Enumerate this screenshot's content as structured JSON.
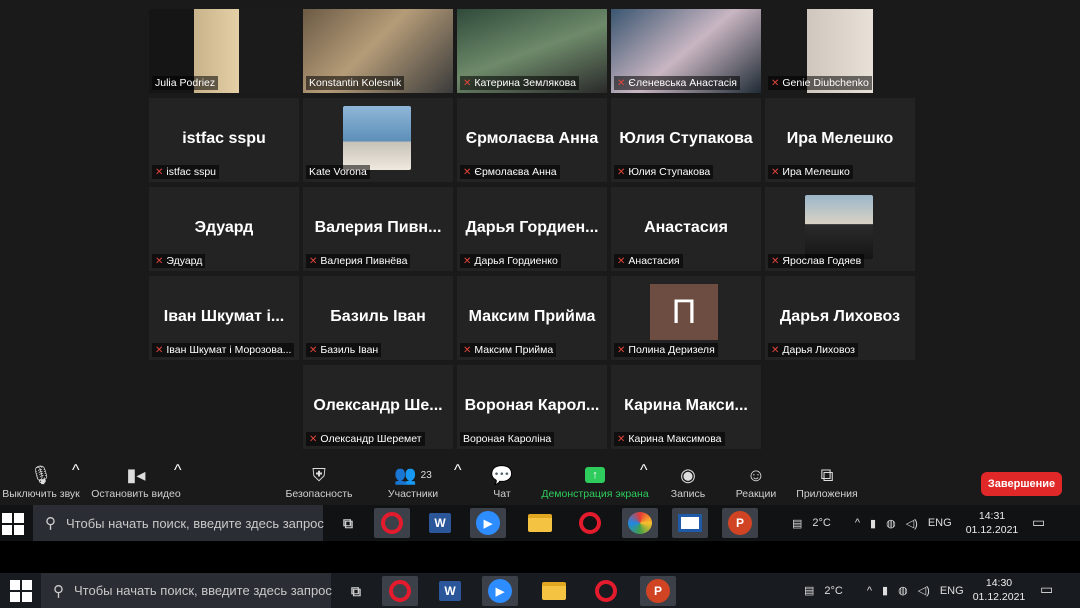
{
  "participants": [
    {
      "big": "",
      "caption": "Julia Podriez",
      "video": "photo",
      "active": true,
      "mic_muted": false
    },
    {
      "big": "",
      "caption": "Konstantin Kolesnik",
      "video": "photo",
      "mic_muted": false
    },
    {
      "big": "",
      "caption": "Катерина Землякова",
      "video": "photo",
      "mic_muted": true
    },
    {
      "big": "",
      "caption": "Єленевська Анастасія",
      "video": "photo",
      "mic_muted": true
    },
    {
      "big": "",
      "caption": "Genie Diubchenko",
      "video": "photo",
      "mic_muted": true
    },
    {
      "big": "istfac sspu",
      "caption": "istfac sspu",
      "video": "none",
      "mic_muted": true
    },
    {
      "big": "",
      "caption": "Kate Vorona",
      "video": "thumb",
      "mic_muted": false
    },
    {
      "big": "Єрмолаєва Анна",
      "caption": "Єрмолаєва Анна",
      "video": "none",
      "mic_muted": true
    },
    {
      "big": "Юлия Ступакова",
      "caption": "Юлия Ступакова",
      "video": "none",
      "mic_muted": true
    },
    {
      "big": "Ира Мелешко",
      "caption": "Ира Мелешко",
      "video": "none",
      "mic_muted": true
    },
    {
      "big": "Эдуард",
      "caption": "Эдуард",
      "video": "none",
      "mic_muted": true
    },
    {
      "big": "Валерия Пивн...",
      "caption": "Валерия Пивнёва",
      "video": "none",
      "mic_muted": true
    },
    {
      "big": "Дарья Гордиен...",
      "caption": "Дарья Гордиенко",
      "video": "none",
      "mic_muted": true
    },
    {
      "big": "Анастасия",
      "caption": "Анастасия",
      "video": "none",
      "mic_muted": true
    },
    {
      "big": "",
      "caption": "Ярослав Годяев",
      "video": "thumb",
      "mic_muted": true
    },
    {
      "big": "Іван Шкумат і...",
      "caption": "Іван Шкумат і Морозова...",
      "video": "none",
      "mic_muted": true
    },
    {
      "big": "Базиль Іван",
      "caption": "Базиль Іван",
      "video": "none",
      "mic_muted": true
    },
    {
      "big": "Максим Прийма",
      "caption": "Максим Прийма",
      "video": "none",
      "mic_muted": true
    },
    {
      "big": "П",
      "caption": "Полина Деризеля",
      "video": "initial",
      "mic_muted": true
    },
    {
      "big": "Дарья Лиховоз",
      "caption": "Дарья Лиховоз",
      "video": "none",
      "mic_muted": true
    },
    {
      "big": "Олександр Ше...",
      "caption": "Олександр Шеремет",
      "video": "none",
      "mic_muted": true
    },
    {
      "big": "Вороная Карол...",
      "caption": "Вороная Кароліна",
      "video": "none",
      "mic_muted": false
    },
    {
      "big": "Карина Макси...",
      "caption": "Карина Максимова",
      "video": "none",
      "mic_muted": true
    }
  ],
  "toolbar": {
    "mute": "Выключить звук",
    "video": "Остановить видео",
    "security": "Безопасность",
    "participants": "Участники",
    "participants_count": "23",
    "chat": "Чат",
    "share": "Демонстрация экрана",
    "record": "Запись",
    "reactions": "Реакции",
    "apps": "Приложения",
    "end": "Завершение"
  },
  "taskbar_top": {
    "search_placeholder": "Чтобы начать поиск, введите здесь запрос",
    "weather": "2°C",
    "lang": "ENG",
    "time": "14:31",
    "date": "01.12.2021"
  },
  "taskbar_bottom": {
    "search_placeholder": "Чтобы начать поиск, введите здесь запрос",
    "weather": "2°C",
    "lang": "ENG",
    "time": "14:30",
    "date": "01.12.2021"
  }
}
